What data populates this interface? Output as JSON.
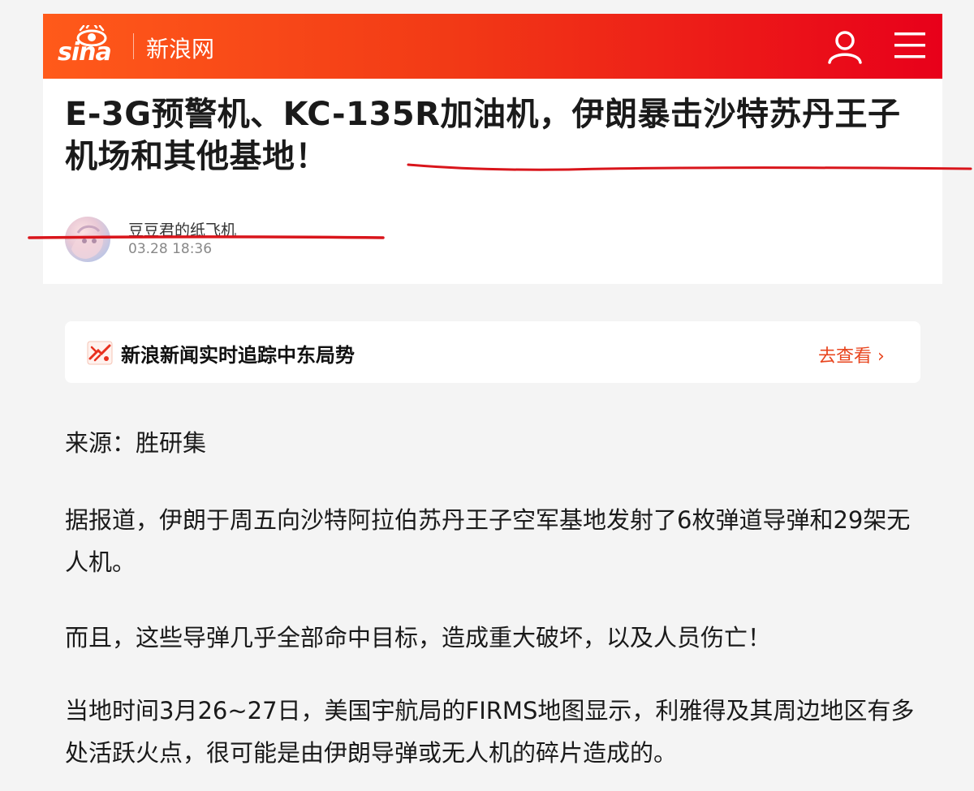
{
  "header": {
    "logo_text": "sina",
    "site_name": "新浪网"
  },
  "article_header": {
    "title": "E-3G预警机、KC-135R加油机，伊朗暴击沙特苏丹王子机场和其他基地！",
    "author": "豆豆君的纸飞机",
    "time": "03.28 18:36"
  },
  "tracker": {
    "label": "新浪新闻实时追踪中东局势",
    "link_text": "去查看 ›"
  },
  "article": {
    "source": "来源：胜研集",
    "paragraphs": [
      "据报道，伊朗于周五向沙特阿拉伯苏丹王子空军基地发射了6枚弹道导弹和29架无人机。",
      "而且，这些导弹几乎全部命中目标，造成重大破坏，以及人员伤亡！",
      "当地时间3月26~27日，美国宇航局的FIRMS地图显示，利雅得及其周边地区有多处活跃火点，很可能是由伊朗导弹或无人机的碎片造成的。"
    ]
  },
  "icons": {
    "user": "user-icon",
    "menu": "menu-icon",
    "tracker": "news-tracker-icon"
  },
  "colors": {
    "header_start": "#ff5a1a",
    "header_end": "#e8001a",
    "link": "#e8451e",
    "annotation": "#d9151b"
  }
}
